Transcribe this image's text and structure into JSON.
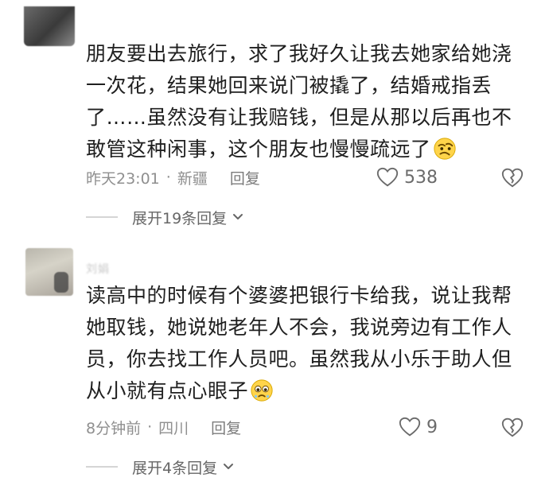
{
  "comments": [
    {
      "username": "",
      "content": "朋友要出去旅行，求了我好久让我去她家给她浇一次花，结果她回来说门被撬了，结婚戒指丢了……虽然没有让我赔钱，但是从那以后再也不敢管这种闲事，这个朋友也慢慢疏远了",
      "time": "昨天23:01",
      "dot": "·",
      "location": "新疆",
      "reply_label": "回复",
      "like_count": "538",
      "expand_label": "展开19条回复"
    },
    {
      "username": "刘娟",
      "content": "读高中的时候有个婆婆把银行卡给我，说让我帮她取钱，她说她老年人不会，我说旁边有工作人员，你去找工作人员吧。虽然我从小乐于助人但从小就有点心眼子",
      "time": "8分钟前",
      "dot": "·",
      "location": "四川",
      "reply_label": "回复",
      "like_count": "9",
      "expand_label": "展开4条回复"
    }
  ],
  "icons": {
    "like": "heart-outline-icon",
    "dislike": "broken-heart-icon",
    "expand": "chevron-down-icon",
    "emoji_1": "skeptical-emoji",
    "emoji_2": "teary-emoji"
  },
  "colors": {
    "text_primary": "#202020",
    "text_secondary": "#8f8f8f",
    "icon": "#6b6b6b",
    "divider": "#d5d5d5"
  }
}
